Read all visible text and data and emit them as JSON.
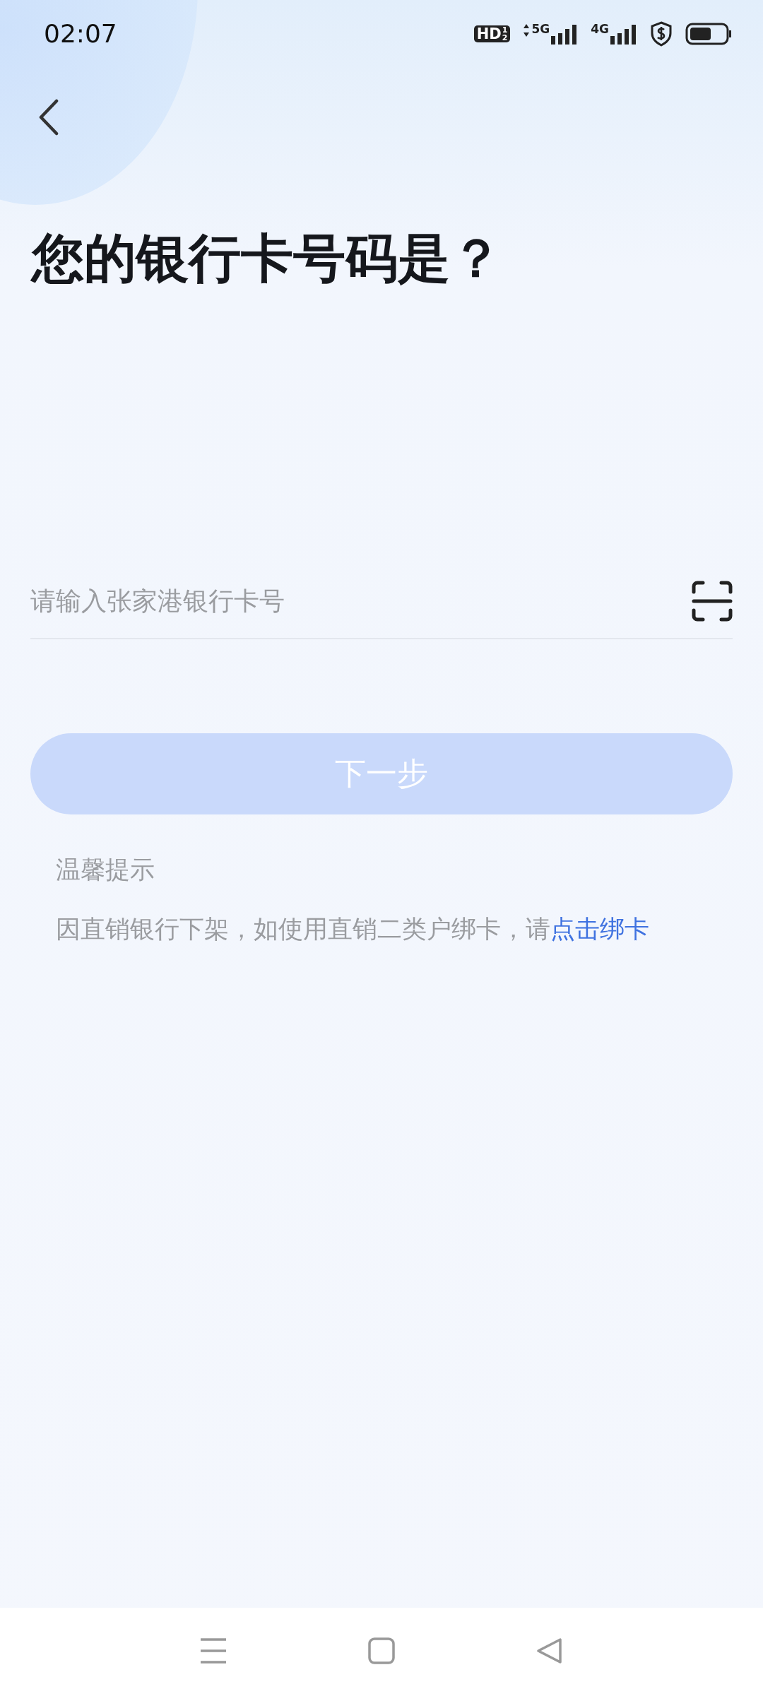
{
  "status_bar": {
    "time": "02:07",
    "hd": {
      "label": "HD",
      "sims": [
        "1",
        "2"
      ]
    },
    "networks": [
      {
        "label": "5G",
        "arrows": true
      },
      {
        "label": "4G",
        "arrows": false
      }
    ]
  },
  "title": "您的银行卡号码是？",
  "card_field": {
    "placeholder": "请输入张家港银行卡号"
  },
  "next_button": {
    "label": "下一步",
    "disabled": true
  },
  "tips": {
    "heading": "温馨提示",
    "text": "因直销银行下架，如使用直销二类户绑卡，请",
    "link": "点击绑卡"
  }
}
